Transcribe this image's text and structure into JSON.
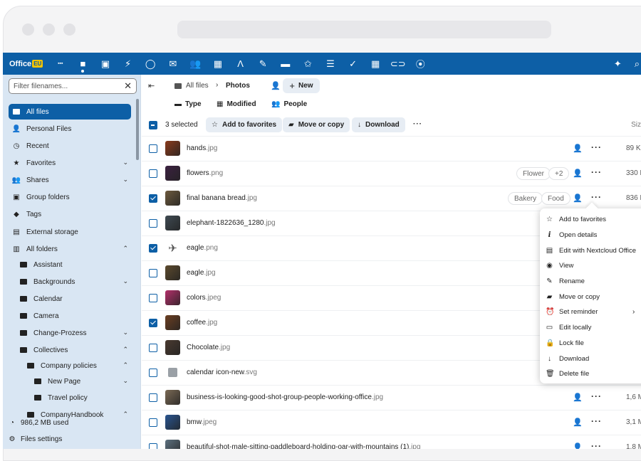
{
  "app": {
    "logo_text": "Office",
    "logo_badge": "EU",
    "accent": "#0d5fa6"
  },
  "topbar": {
    "apps": [
      {
        "name": "dashboard-icon",
        "glyph": "▪▪▪"
      },
      {
        "name": "files-icon",
        "glyph": "■"
      },
      {
        "name": "photos-icon",
        "glyph": "▣"
      },
      {
        "name": "activity-icon",
        "glyph": "⚡"
      },
      {
        "name": "search-app-icon",
        "glyph": "◯"
      },
      {
        "name": "mail-icon",
        "glyph": "✉"
      },
      {
        "name": "contacts-icon",
        "glyph": "👥"
      },
      {
        "name": "calendar-icon",
        "glyph": "▦"
      },
      {
        "name": "notes-icon",
        "glyph": "Ʌ"
      },
      {
        "name": "edit-icon",
        "glyph": "✎"
      },
      {
        "name": "deck-icon",
        "glyph": "▬"
      },
      {
        "name": "favorites-icon",
        "glyph": "✩"
      },
      {
        "name": "tasks-icon",
        "glyph": "☰"
      },
      {
        "name": "check-icon",
        "glyph": "✓"
      },
      {
        "name": "tables-icon",
        "glyph": "▦"
      },
      {
        "name": "link-icon",
        "glyph": "⊂⊃"
      },
      {
        "name": "maps-icon",
        "glyph": "⦿"
      }
    ],
    "right_icons": [
      {
        "name": "assistant-sparkle-icon",
        "glyph": "✦"
      },
      {
        "name": "search-icon",
        "glyph": "⌕"
      }
    ]
  },
  "sidebar": {
    "filter_placeholder": "Filter filenames...",
    "items": [
      {
        "label": "All files",
        "icon": "folder-icon",
        "active": true
      },
      {
        "label": "Personal Files",
        "icon": "user-icon"
      },
      {
        "label": "Recent",
        "icon": "history-icon"
      },
      {
        "label": "Favorites",
        "icon": "star-icon",
        "chevron": "⌄"
      },
      {
        "label": "Shares",
        "icon": "share-icon",
        "chevron": "⌄"
      },
      {
        "label": "Group folders",
        "icon": "group-folder-icon"
      },
      {
        "label": "Tags",
        "icon": "tag-icon"
      },
      {
        "label": "External storage",
        "icon": "external-storage-icon"
      },
      {
        "label": "All folders",
        "icon": "folders-icon",
        "chevron": "⌃"
      },
      {
        "label": "Assistant",
        "icon": "folder-icon",
        "indent": 1
      },
      {
        "label": "Backgrounds",
        "icon": "folder-icon",
        "indent": 1,
        "chevron": "⌄"
      },
      {
        "label": "Calendar",
        "icon": "folder-icon",
        "indent": 1
      },
      {
        "label": "Camera",
        "icon": "folder-icon",
        "indent": 1
      },
      {
        "label": "Change-Prozess",
        "icon": "folder-icon",
        "indent": 1,
        "chevron": "⌄"
      },
      {
        "label": "Collectives",
        "icon": "folder-icon",
        "indent": 1,
        "chevron": "⌃"
      },
      {
        "label": "Company policies",
        "icon": "folder-icon",
        "indent": 2,
        "chevron": "⌃"
      },
      {
        "label": "New Page",
        "icon": "folder-icon",
        "indent": 3,
        "chevron": "⌄"
      },
      {
        "label": "Travel policy",
        "icon": "folder-icon",
        "indent": 3
      },
      {
        "label": "CompanyHandbook",
        "icon": "folder-icon",
        "indent": 2,
        "chevron": "⌃"
      }
    ],
    "storage_used": "986,2 MB used",
    "settings_label": "Files settings"
  },
  "breadcrumb": {
    "root": "All files",
    "current": "Photos",
    "new_label": "New"
  },
  "filters": [
    "Type",
    "Modified",
    "People"
  ],
  "actions": {
    "selected_count": "3 selected",
    "add_favorites": "Add to favorites",
    "move_copy": "Move or copy",
    "download": "Download",
    "size_header": "Siz"
  },
  "files": [
    {
      "name": "hands",
      "ext": ".jpg",
      "checked": false,
      "size": "89 K",
      "tags": [],
      "thumb": "#8a3b1c"
    },
    {
      "name": "flowers",
      "ext": ".png",
      "checked": false,
      "size": "330 K",
      "tags": [
        "Flower",
        "+2"
      ],
      "thumb": "#3b2140"
    },
    {
      "name": "final banana bread",
      "ext": ".jpg",
      "checked": true,
      "size": "836 K",
      "tags": [
        "Bakery",
        "Food"
      ],
      "thumb": "#6d5a3e"
    },
    {
      "name": "elephant-1822636_1280",
      "ext": ".jpg",
      "checked": false,
      "size": "",
      "tags": [],
      "thumb": "#3f4a52"
    },
    {
      "name": "eagle",
      "ext": ".png",
      "checked": true,
      "size": "",
      "tags": [],
      "thumb": "#ffffff"
    },
    {
      "name": "eagle",
      "ext": ".jpg",
      "checked": false,
      "size": "",
      "tags": [],
      "thumb": "#5c4a2e"
    },
    {
      "name": "colors",
      "ext": ".jpeg",
      "checked": false,
      "size": "",
      "tags": [],
      "thumb": "#b3306a"
    },
    {
      "name": "coffee",
      "ext": ".jpg",
      "checked": true,
      "size": "",
      "tags": [],
      "thumb": "#6b3f22"
    },
    {
      "name": "Chocolate",
      "ext": ".jpg",
      "checked": false,
      "size": "",
      "tags": [],
      "thumb": "#4a3a30"
    },
    {
      "name": "calendar icon-new",
      "ext": ".svg",
      "checked": false,
      "size": "",
      "tags": [],
      "thumb": "#d8d8d8"
    },
    {
      "name": "business-is-looking-good-shot-group-people-working-office",
      "ext": ".jpg",
      "checked": false,
      "size": "1,6 M",
      "tags": [],
      "thumb": "#7b6a55"
    },
    {
      "name": "bmw",
      "ext": ".jpeg",
      "checked": false,
      "size": "3,1 M",
      "tags": [],
      "thumb": "#2a5590"
    },
    {
      "name": "beautiful-shot-male-sitting-paddleboard-holding-oar-with-mountains (1)",
      "ext": ".jpg",
      "checked": false,
      "size": "1,8 M",
      "tags": [],
      "thumb": "#5d7180"
    }
  ],
  "context_menu": [
    {
      "label": "Add to favorites",
      "icon": "star-outline-icon",
      "glyph": "☆"
    },
    {
      "label": "Open details",
      "icon": "info-icon",
      "glyph": "i"
    },
    {
      "label": "Edit with Nextcloud Office",
      "icon": "document-icon",
      "glyph": "▤"
    },
    {
      "label": "View",
      "icon": "eye-icon",
      "glyph": "◉"
    },
    {
      "label": "Rename",
      "icon": "pencil-icon",
      "glyph": "✎"
    },
    {
      "label": "Move or copy",
      "icon": "folder-move-icon",
      "glyph": "▰"
    },
    {
      "label": "Set reminder",
      "icon": "alarm-icon",
      "glyph": "⏰",
      "arrow": "›"
    },
    {
      "label": "Edit locally",
      "icon": "laptop-icon",
      "glyph": "▭"
    },
    {
      "label": "Lock file",
      "icon": "lock-icon",
      "glyph": "🔒"
    },
    {
      "label": "Download",
      "icon": "download-icon",
      "glyph": "↓"
    },
    {
      "label": "Delete file",
      "icon": "trash-icon",
      "glyph": "🗑"
    }
  ]
}
